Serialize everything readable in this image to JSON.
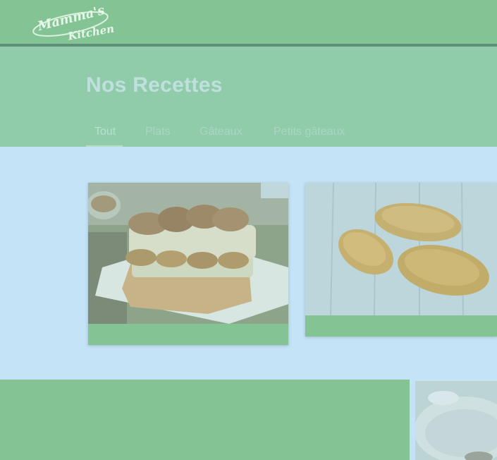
{
  "header": {
    "logo_line1": "Mamma's",
    "logo_line2": "Kitchen"
  },
  "hero": {
    "title": "Nos Recettes",
    "tabs": [
      {
        "label": "Tout",
        "active": true
      },
      {
        "label": "Plats",
        "active": false
      },
      {
        "label": "Gâteaux",
        "active": false
      },
      {
        "label": "Petits gâteaux",
        "active": false
      }
    ]
  },
  "recipes": [
    {
      "image": "tiramisu-photo"
    },
    {
      "image": "madeleines-photo"
    },
    {
      "image": "plate-photo"
    }
  ],
  "colors": {
    "header_green": "#84c494",
    "hero_green": "#90ccaa",
    "page_background": "#c4e3f6",
    "card_footer": "#84c494"
  }
}
